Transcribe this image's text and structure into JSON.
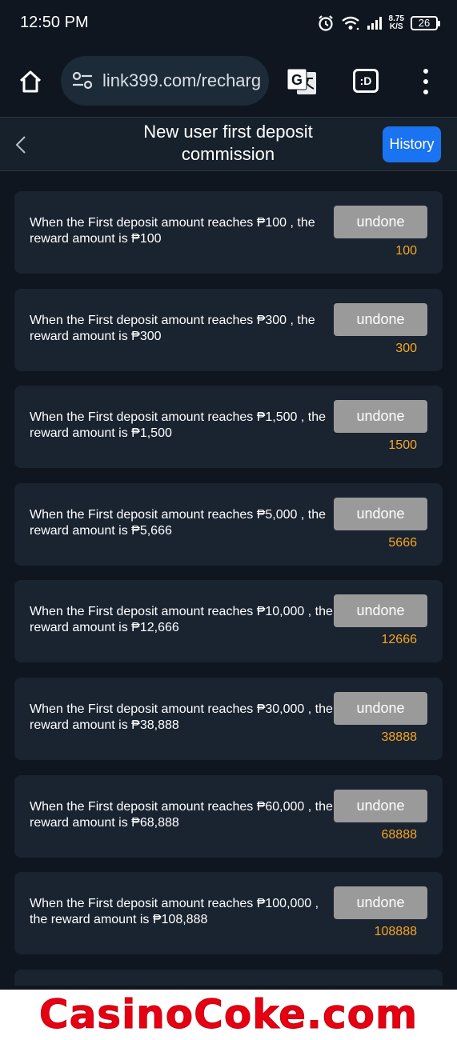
{
  "status_bar": {
    "time": "12:50 PM",
    "speed_value": "8.75",
    "speed_unit": "K/S",
    "battery": "26"
  },
  "browser": {
    "url": "link399.com/recharg",
    "icons": [
      "home-icon",
      "site-settings-icon",
      "translate-icon",
      "desktop-mode-icon",
      "more-vert-icon"
    ],
    "desktop_label": ":D"
  },
  "header": {
    "title": "New user first deposit commission",
    "history_label": "History"
  },
  "colors": {
    "background": "#0f1620",
    "card": "#1a2330",
    "accent_blue": "#1a73f0",
    "amount_orange": "#f5a623",
    "button_gray": "#9a9a9a",
    "watermark_red": "#e60012"
  },
  "rewards": [
    {
      "text": "When the First deposit amount reaches ₱100 , the reward amount is ₱100",
      "button": "undone",
      "amount": "100"
    },
    {
      "text": "When the First deposit amount reaches ₱300 , the reward amount is ₱300",
      "button": "undone",
      "amount": "300"
    },
    {
      "text": "When the First deposit amount reaches ₱1,500 , the reward amount is ₱1,500",
      "button": "undone",
      "amount": "1500"
    },
    {
      "text": "When the First deposit amount reaches ₱5,000 , the reward amount is ₱5,666",
      "button": "undone",
      "amount": "5666"
    },
    {
      "text": "When the First deposit amount reaches ₱10,000 , the reward amount is ₱12,666",
      "button": "undone",
      "amount": "12666"
    },
    {
      "text": "When the First deposit amount reaches ₱30,000 , the reward amount is ₱38,888",
      "button": "undone",
      "amount": "38888"
    },
    {
      "text": "When the First deposit amount reaches ₱60,000 , the reward amount is ₱68,888",
      "button": "undone",
      "amount": "68888"
    },
    {
      "text": "When the First deposit amount reaches ₱100,000 , the reward amount is ₱108,888",
      "button": "undone",
      "amount": "108888"
    }
  ],
  "watermark": {
    "text": "CasinoCoke.com"
  }
}
